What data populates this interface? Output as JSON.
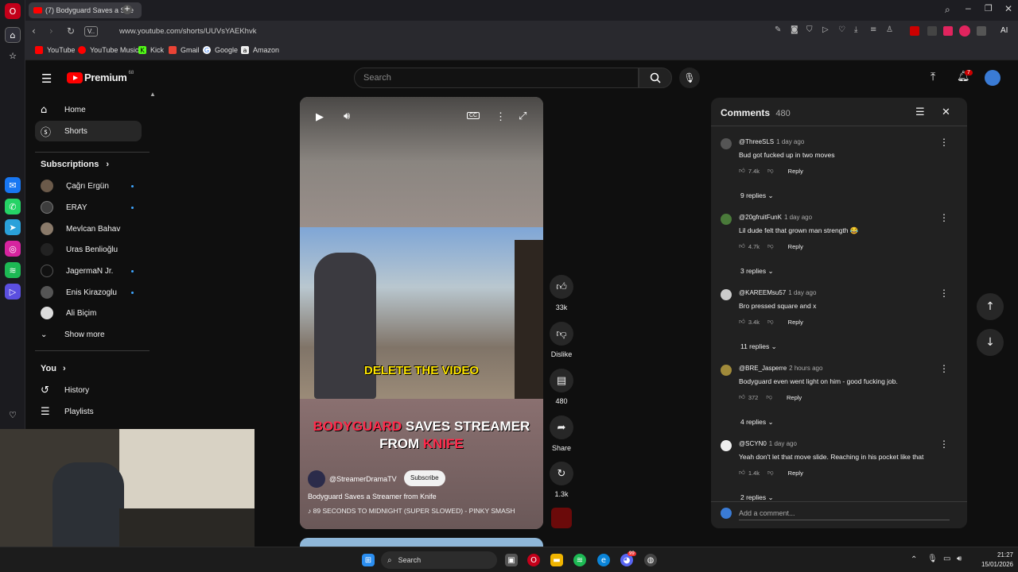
{
  "browser": {
    "tab_title": "(7) Bodyguard Saves a Stre",
    "url": "www.youtube.com/shorts/UUVsYAEKhvk",
    "url_badge": "V..",
    "ai_label": "AI",
    "bookmarks": [
      "YouTube",
      "YouTube Music",
      "Kick",
      "Gmail",
      "Google",
      "Amazon"
    ]
  },
  "yt": {
    "brand": "Premium",
    "brand_sup": "68",
    "search_placeholder": "Search",
    "notif_count": "7",
    "nav": [
      {
        "label": "Home",
        "icon": "home-icon"
      },
      {
        "label": "Shorts",
        "icon": "shorts-icon"
      }
    ],
    "subscriptions_title": "Subscriptions",
    "subscriptions": [
      {
        "name": "Çağrı Ergün",
        "live": true
      },
      {
        "name": "ERAY",
        "live": true
      },
      {
        "name": "Mevlcan Bahav",
        "live": false
      },
      {
        "name": "Uras Benlioğlu",
        "live": false
      },
      {
        "name": "JagermaN Jr.",
        "live": true
      },
      {
        "name": "Enis Kirazoglu",
        "live": true
      },
      {
        "name": "Ali Biçim",
        "live": false
      }
    ],
    "show_more": "Show more",
    "you_title": "You",
    "you_items": [
      {
        "label": "History",
        "icon": "history-icon"
      },
      {
        "label": "Playlists",
        "icon": "playlists-icon"
      }
    ]
  },
  "video": {
    "overlay_caption": "DELETE THE VIDEO",
    "headline_red": "BODYGUARD",
    "headline_white_1": "SAVES STREAMER",
    "headline_white_2": "FROM",
    "headline_red_2": "KNIFE",
    "channel": "@StreamerDramaTV",
    "subscribe": "Subscribe",
    "title": "Bodyguard Saves a Streamer from Knife",
    "sound": "89 SECONDS TO MIDNIGHT (SUPER SLOWED) - PINKY SMASH",
    "actions": {
      "likes": "33k",
      "dislike": "Dislike",
      "comments": "480",
      "share": "Share",
      "remix": "1.3k"
    }
  },
  "comments": {
    "title": "Comments",
    "count": "480",
    "add_placeholder": "Add a comment...",
    "items": [
      {
        "user": "@ThreeSLS",
        "time": "1 day ago",
        "text": "Bud got fucked up in two moves",
        "likes": "7.4k",
        "reply": "Reply",
        "replies": "9 replies"
      },
      {
        "user": "@20gfruitFunK",
        "time": "1 day ago",
        "text": "Lil dude felt that grown man strength 😂",
        "likes": "4.7k",
        "reply": "Reply",
        "replies": "3 replies"
      },
      {
        "user": "@KAREEMsu57",
        "time": "1 day ago",
        "text": "Bro pressed square and x",
        "likes": "3.4k",
        "reply": "Reply",
        "replies": "11 replies"
      },
      {
        "user": "@BRE_Jasperre",
        "time": "2 hours ago",
        "text": "Bodyguard even went light on him - good fucking job.",
        "likes": "372",
        "reply": "Reply",
        "replies": "4 replies"
      },
      {
        "user": "@SCYN0",
        "time": "1 day ago",
        "text": "Yeah don't let that move slide. Reaching in his pocket like that",
        "likes": "1.4k",
        "reply": "Reply",
        "replies": "2 replies"
      }
    ]
  },
  "taskbar": {
    "search": "Search",
    "time": "21:27",
    "date": "15/01/2026",
    "discord_badge": "99"
  }
}
